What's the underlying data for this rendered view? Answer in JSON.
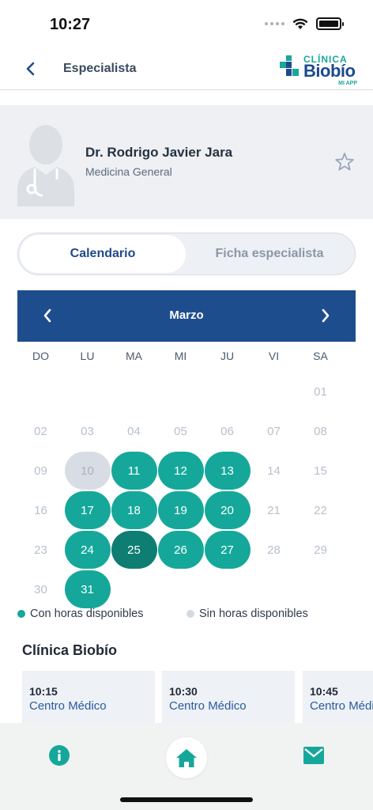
{
  "status_bar": {
    "time": "10:27"
  },
  "nav": {
    "title": "Especialista",
    "logo_small": "CLÍNICA",
    "logo_big": "Biobío",
    "logo_tag": "MI APP"
  },
  "doctor": {
    "name": "Dr. Rodrigo Javier Jara",
    "specialty": "Medicina General"
  },
  "tabs": [
    {
      "label": "Calendario",
      "active": true
    },
    {
      "label": "Ficha especialista",
      "active": false
    }
  ],
  "calendar": {
    "month": "Marzo",
    "weekdays": [
      "DO",
      "LU",
      "MA",
      "MI",
      "JU",
      "VI",
      "SA"
    ],
    "days": [
      {
        "n": "01",
        "state": "disabled"
      },
      {
        "n": "02",
        "state": "disabled"
      },
      {
        "n": "03",
        "state": "disabled"
      },
      {
        "n": "04",
        "state": "disabled"
      },
      {
        "n": "05",
        "state": "disabled"
      },
      {
        "n": "06",
        "state": "disabled"
      },
      {
        "n": "07",
        "state": "disabled"
      },
      {
        "n": "08",
        "state": "disabled"
      },
      {
        "n": "09",
        "state": "disabled"
      },
      {
        "n": "10",
        "state": "unavailable"
      },
      {
        "n": "11",
        "state": "available"
      },
      {
        "n": "12",
        "state": "available"
      },
      {
        "n": "13",
        "state": "available"
      },
      {
        "n": "14",
        "state": "disabled"
      },
      {
        "n": "15",
        "state": "disabled"
      },
      {
        "n": "16",
        "state": "disabled"
      },
      {
        "n": "17",
        "state": "available"
      },
      {
        "n": "18",
        "state": "available"
      },
      {
        "n": "19",
        "state": "available"
      },
      {
        "n": "20",
        "state": "available"
      },
      {
        "n": "21",
        "state": "disabled"
      },
      {
        "n": "22",
        "state": "disabled"
      },
      {
        "n": "23",
        "state": "disabled"
      },
      {
        "n": "24",
        "state": "available"
      },
      {
        "n": "25",
        "state": "selected"
      },
      {
        "n": "26",
        "state": "available"
      },
      {
        "n": "27",
        "state": "available"
      },
      {
        "n": "28",
        "state": "disabled"
      },
      {
        "n": "29",
        "state": "disabled"
      },
      {
        "n": "30",
        "state": "disabled"
      },
      {
        "n": "31",
        "state": "available"
      }
    ],
    "first_weekday_index": 6
  },
  "legend": {
    "available": "Con horas disponibles",
    "unavailable": "Sin horas disponibles"
  },
  "section": {
    "title": "Clínica Biobío"
  },
  "slots": [
    {
      "time": "10:15",
      "place": "Centro Médico"
    },
    {
      "time": "10:30",
      "place": "Centro Médico"
    },
    {
      "time": "10:45",
      "place": "Centro Médico"
    }
  ],
  "colors": {
    "teal": "#15a89a",
    "teal_dark": "#0e7d72",
    "navy": "#1e4d8e",
    "unavailable": "#d8dde5"
  },
  "icons": {
    "back": "chevron-left-icon",
    "star": "star-outline-icon",
    "info": "info-icon",
    "home": "home-icon",
    "mail": "mail-icon"
  }
}
